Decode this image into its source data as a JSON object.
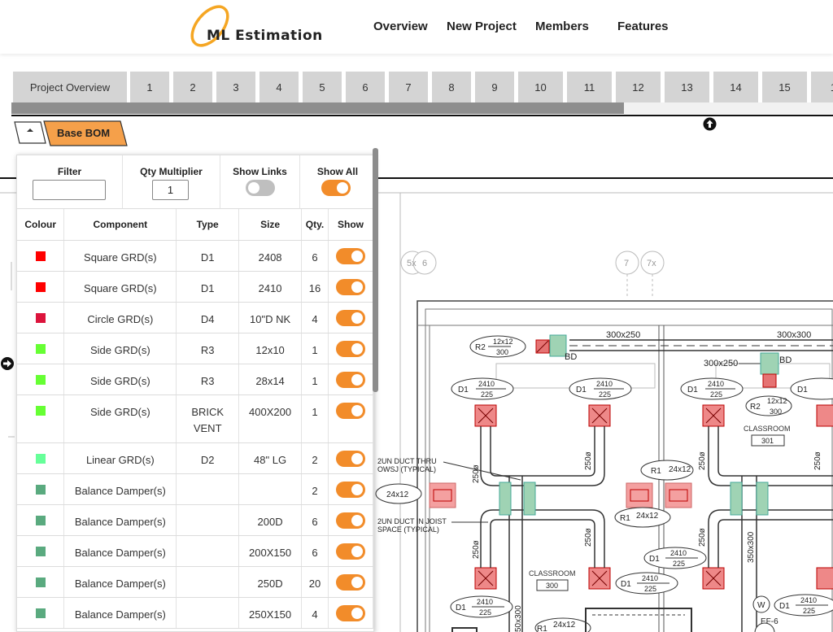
{
  "navbar": {
    "logo_text": "ML Estimation",
    "items": [
      "Overview",
      "New Project",
      "Members",
      "Features"
    ]
  },
  "tabs": [
    "Project Overview",
    "1",
    "2",
    "3",
    "4",
    "5",
    "6",
    "7",
    "8",
    "9",
    "10",
    "11",
    "12",
    "13",
    "14",
    "15",
    "1"
  ],
  "bom_tab": {
    "label": "Base BOM"
  },
  "panel": {
    "filter_label": "Filter",
    "filter_value": "",
    "qty_label": "Qty Multiplier",
    "qty_value": "1",
    "show_links_label": "Show Links",
    "show_links_on": false,
    "show_all_label": "Show All",
    "show_all_on": true,
    "columns": [
      "Colour",
      "Component",
      "Type",
      "Size",
      "Qty.",
      "Show"
    ],
    "rows": [
      {
        "color": "#ff0000",
        "component": "Square GRD(s)",
        "type": "D1",
        "size": "2408",
        "qty": "6"
      },
      {
        "color": "#ff0000",
        "component": "Square GRD(s)",
        "type": "D1",
        "size": "2410",
        "qty": "16"
      },
      {
        "color": "#dc143c",
        "component": "Circle GRD(s)",
        "type": "D4",
        "size": "10\"D NK",
        "qty": "4"
      },
      {
        "color": "#66ff33",
        "component": "Side GRD(s)",
        "type": "R3",
        "size": "12x10",
        "qty": "1"
      },
      {
        "color": "#66ff33",
        "component": "Side GRD(s)",
        "type": "R3",
        "size": "28x14",
        "qty": "1"
      },
      {
        "color": "#66ff33",
        "component": "Side GRD(s)",
        "type": "BRICK VENT",
        "size": "400X200",
        "qty": "1"
      },
      {
        "color": "#66ff99",
        "component": "Linear GRD(s)",
        "type": "D2",
        "size": "48\" LG",
        "qty": "2"
      },
      {
        "color": "#5aaa7f",
        "component": "Balance Damper(s)",
        "type": "",
        "size": "",
        "qty": "2"
      },
      {
        "color": "#5aaa7f",
        "component": "Balance Damper(s)",
        "type": "",
        "size": "200D",
        "qty": "6"
      },
      {
        "color": "#5aaa7f",
        "component": "Balance Damper(s)",
        "type": "",
        "size": "200X150",
        "qty": "6"
      },
      {
        "color": "#5aaa7f",
        "component": "Balance Damper(s)",
        "type": "",
        "size": "250D",
        "qty": "20"
      },
      {
        "color": "#5aaa7f",
        "component": "Balance Damper(s)",
        "type": "",
        "size": "250X150",
        "qty": "4"
      }
    ]
  },
  "drawing": {
    "grid_bubbles": [
      "5x",
      "6",
      "7",
      "7x"
    ],
    "labels": {
      "duct_300x250": "300x250",
      "duct_300x300": "300x300",
      "duct_300x250_b": "300x250",
      "bd1": "BD",
      "bd2": "BD",
      "r2_top": "12x12",
      "r2_bot": "300",
      "r2_tag": "R2",
      "r2b_top": "12x12",
      "r2b_bot": "300",
      "r2b_tag": "R2",
      "d1_top": "2410",
      "d1_bot": "225",
      "d1_tag": "D1",
      "r1_top": "24x12",
      "r1_tag": "R1",
      "classroom": "CLASSROOM",
      "room_301": "301",
      "room_300": "300",
      "note1a": "2UN DUCT THRU",
      "note1b": "OWSJ (TYPICAL)",
      "note2a": "2UN DUCT IN JOIST",
      "note2b": "SPACE (TYPICAL)",
      "dim_250": "250ø",
      "dim_350x300": "350x300",
      "dim_50x300": "50x300",
      "w_tag": "W",
      "ef6": "EF-6",
      "side_tag": "24x12"
    }
  }
}
